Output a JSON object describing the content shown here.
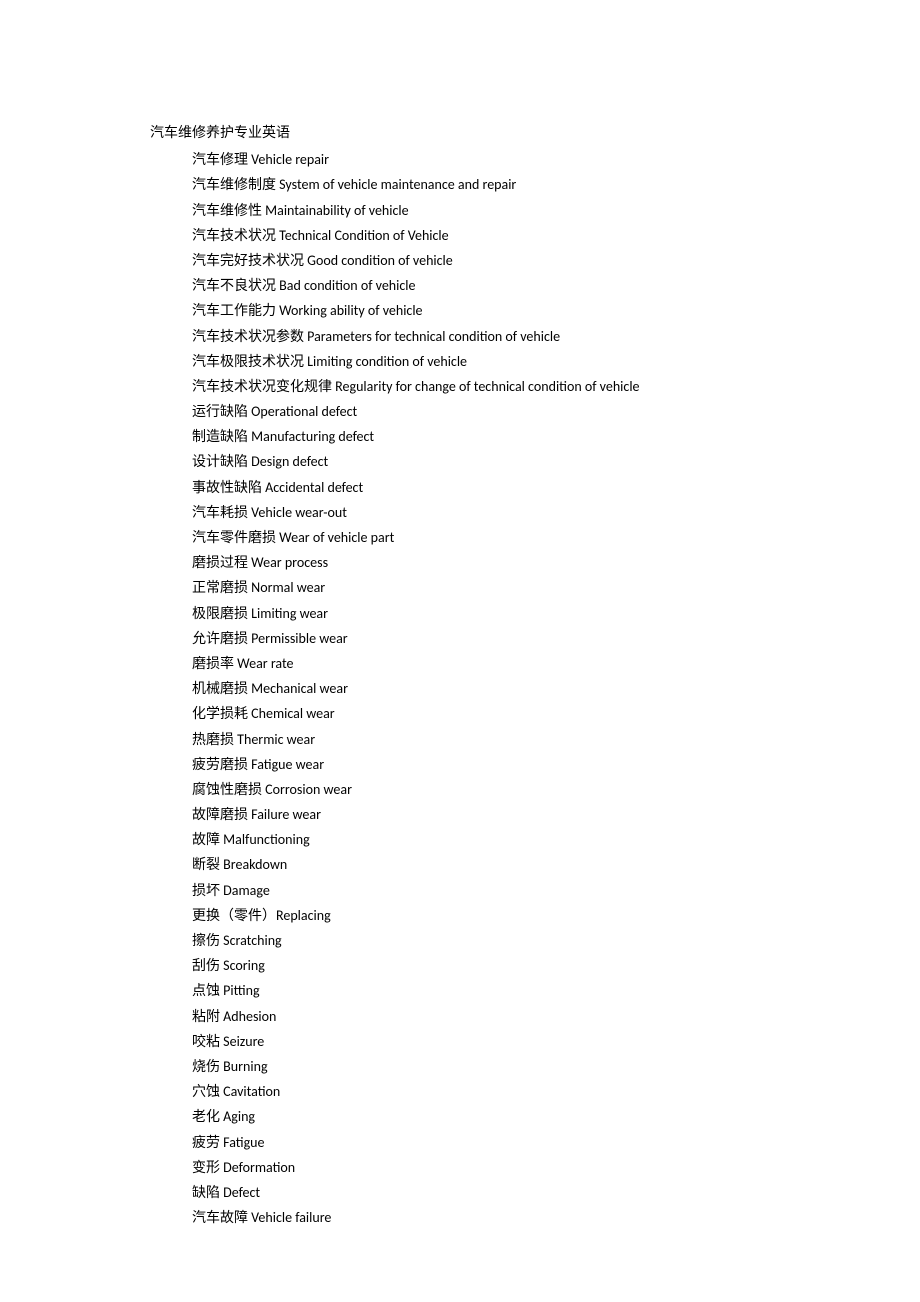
{
  "title": "汽车维修养护专业英语",
  "entries": [
    "汽车修理 Vehicle repair",
    "汽车维修制度 System of vehicle maintenance and repair",
    "汽车维修性 Maintainability of vehicle",
    "汽车技术状况 Technical Condition of Vehicle",
    "汽车完好技术状况 Good condition of vehicle",
    "汽车不良状况 Bad condition of vehicle",
    "汽车工作能力 Working ability of vehicle",
    "汽车技术状况参数 Parameters for technical condition of vehicle",
    "汽车极限技术状况 Limiting condition of vehicle",
    "汽车技术状况变化规律 Regularity for change of technical condition of vehicle",
    "运行缺陷 Operational defect",
    "制造缺陷 Manufacturing defect",
    "设计缺陷 Design defect",
    "事故性缺陷 Accidental defect",
    "汽车耗损 Vehicle wear-out",
    "汽车零件磨损 Wear of vehicle part",
    "磨损过程 Wear process",
    "正常磨损 Normal wear",
    "极限磨损 Limiting wear",
    "允许磨损 Permissible wear",
    "磨损率 Wear rate",
    "机械磨损 Mechanical wear",
    "化学损耗 Chemical wear",
    "热磨损 Thermic wear",
    "疲劳磨损 Fatigue wear",
    "腐蚀性磨损 Corrosion wear",
    "故障磨损 Failure wear",
    "故障 Malfunctioning",
    "断裂 Breakdown",
    "损坏 Damage",
    "更换（零件）Replacing",
    "擦伤 Scratching",
    "刮伤 Scoring",
    "点蚀 Pitting",
    "粘附 Adhesion",
    "咬粘 Seizure",
    "烧伤 Burning",
    "穴蚀 Cavitation",
    "老化 Aging",
    "疲劳  Fatigue",
    "变形 Deformation",
    "缺陷 Defect",
    "汽车故障 Vehicle failure"
  ]
}
